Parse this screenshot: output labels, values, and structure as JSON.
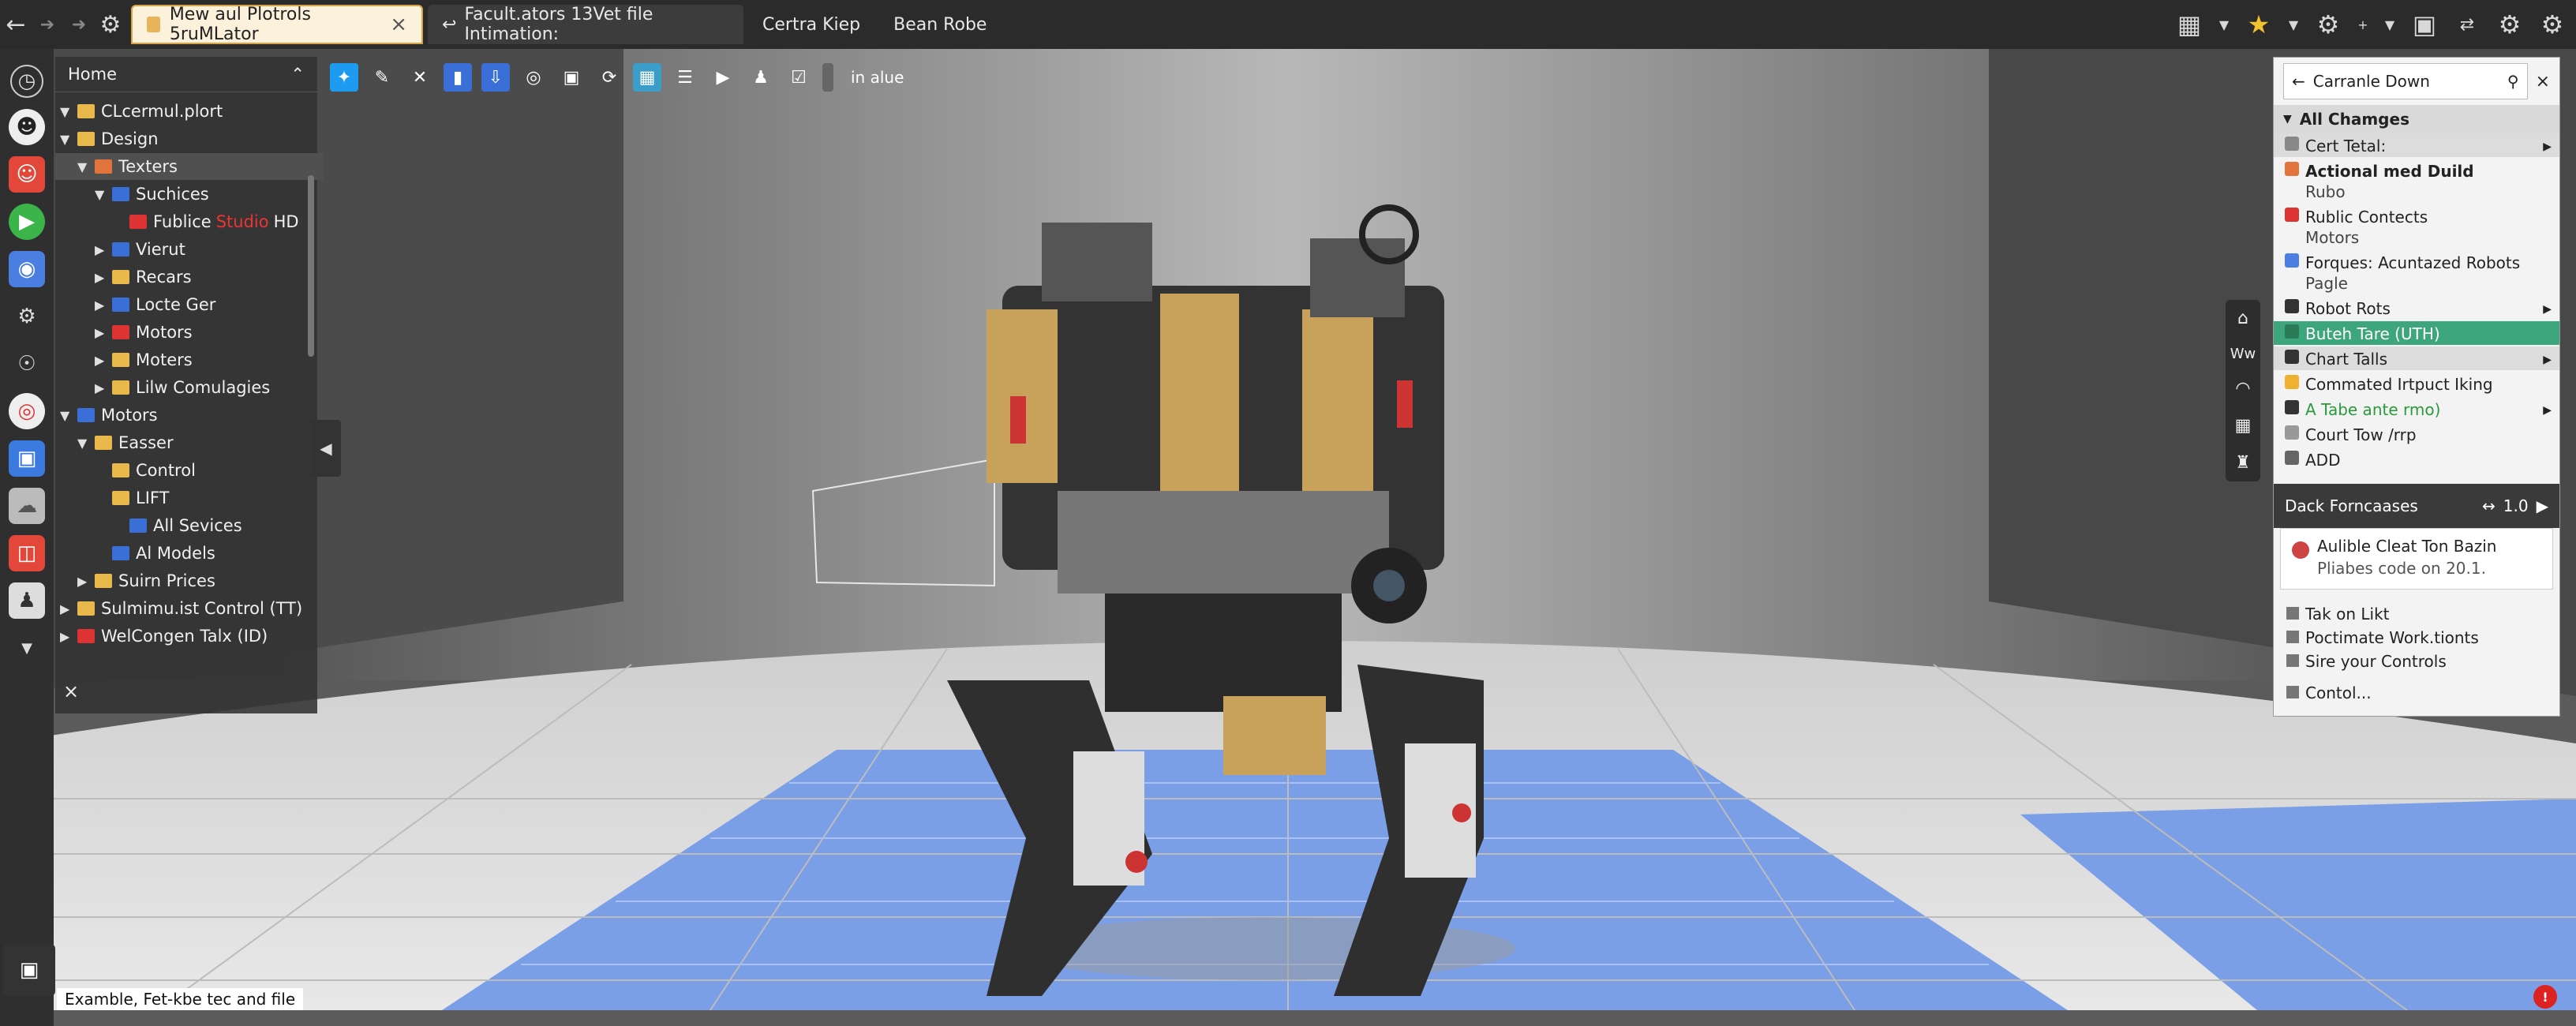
{
  "topbar": {
    "tabs": [
      {
        "label": "Mew aul Plotrols 5ruMLator",
        "active": true
      },
      {
        "label": "Facult.ators  13Vet file Intimation:",
        "active": false
      },
      {
        "label": "Certra Kiep",
        "active": false
      },
      {
        "label": "Bean Robe",
        "active": false
      }
    ]
  },
  "tree": {
    "header": "Home",
    "items": [
      {
        "label": "CLcermul.plort",
        "depth": 0,
        "expanded": true,
        "icon": "folder"
      },
      {
        "label": "Design",
        "depth": 0,
        "expanded": true,
        "icon": "folder"
      },
      {
        "label": "Texters",
        "depth": 1,
        "expanded": true,
        "icon": "orange",
        "selected": true
      },
      {
        "label": "Suchices",
        "depth": 2,
        "expanded": true,
        "icon": "blue"
      },
      {
        "label": "Fublice",
        "extra": "Studio",
        "extra2": "HD",
        "depth": 3,
        "icon": "red"
      },
      {
        "label": "Vierut",
        "depth": 2,
        "expanded": false,
        "icon": "blue"
      },
      {
        "label": "Recars",
        "depth": 2,
        "expanded": false,
        "icon": "folder"
      },
      {
        "label": "Locte Ger",
        "depth": 2,
        "expanded": false,
        "icon": "blue"
      },
      {
        "label": "Motors",
        "depth": 2,
        "expanded": false,
        "icon": "red"
      },
      {
        "label": "Moters",
        "depth": 2,
        "expanded": false,
        "icon": "folder"
      },
      {
        "label": "Lilw Comulagies",
        "depth": 2,
        "expanded": false,
        "icon": "folder"
      },
      {
        "label": "Motors",
        "depth": 0,
        "expanded": true,
        "icon": "blue"
      },
      {
        "label": "Easser",
        "depth": 1,
        "expanded": true,
        "icon": "folder"
      },
      {
        "label": "Control",
        "depth": 2,
        "icon": "folder"
      },
      {
        "label": "LIFT",
        "depth": 2,
        "icon": "folder"
      },
      {
        "label": "All Sevices",
        "depth": 3,
        "icon": "blue"
      },
      {
        "label": "Al Models",
        "depth": 2,
        "icon": "blue"
      },
      {
        "label": "Suirn Prices",
        "depth": 1,
        "expanded": false,
        "icon": "folder"
      },
      {
        "label": "Sulmimu.ist Control (TT)",
        "depth": 0,
        "expanded": false,
        "icon": "folder"
      },
      {
        "label": "WelCongen Talx (ID)",
        "depth": 0,
        "expanded": false,
        "icon": "red"
      }
    ],
    "close": "×"
  },
  "viewport_toolbar": {
    "label": "in alue"
  },
  "right_panel": {
    "search_value": "Carranle Down",
    "section_title": "All Chamges",
    "items": [
      {
        "label": "Cert Tetal:",
        "header": true
      },
      {
        "label": "Actional med Duild",
        "sub": "Rubo",
        "bold": true
      },
      {
        "label": "Rublic Contects",
        "sub": "Motors"
      },
      {
        "label": "Forques: Acuntazed Robots",
        "sub": "Pagle"
      },
      {
        "label": "Robot Rots"
      },
      {
        "label": "Buteh Tare (UTH)",
        "highlight": true
      },
      {
        "label": "Chart Talls",
        "header": true
      },
      {
        "label": "Commated Irtpuct Iking"
      },
      {
        "label": "A Tabe ante rmo)",
        "green_text": true
      },
      {
        "label": "Court Tow /rrp"
      },
      {
        "label": "ADD"
      }
    ],
    "dark_bar": {
      "label": "Dack Forncaases",
      "value": "1.0"
    },
    "notice": {
      "title": "Aulible Cleat Ton Bazin",
      "sub": "Pliabes code on 20.1."
    },
    "bottom_items": [
      "Tak on Likt",
      "Poctimate Work.tionts",
      "Sire your Controls",
      "Contol..."
    ]
  },
  "status_text": "Examble,  Fet-kbe tec  and file",
  "alert_badge": "!"
}
